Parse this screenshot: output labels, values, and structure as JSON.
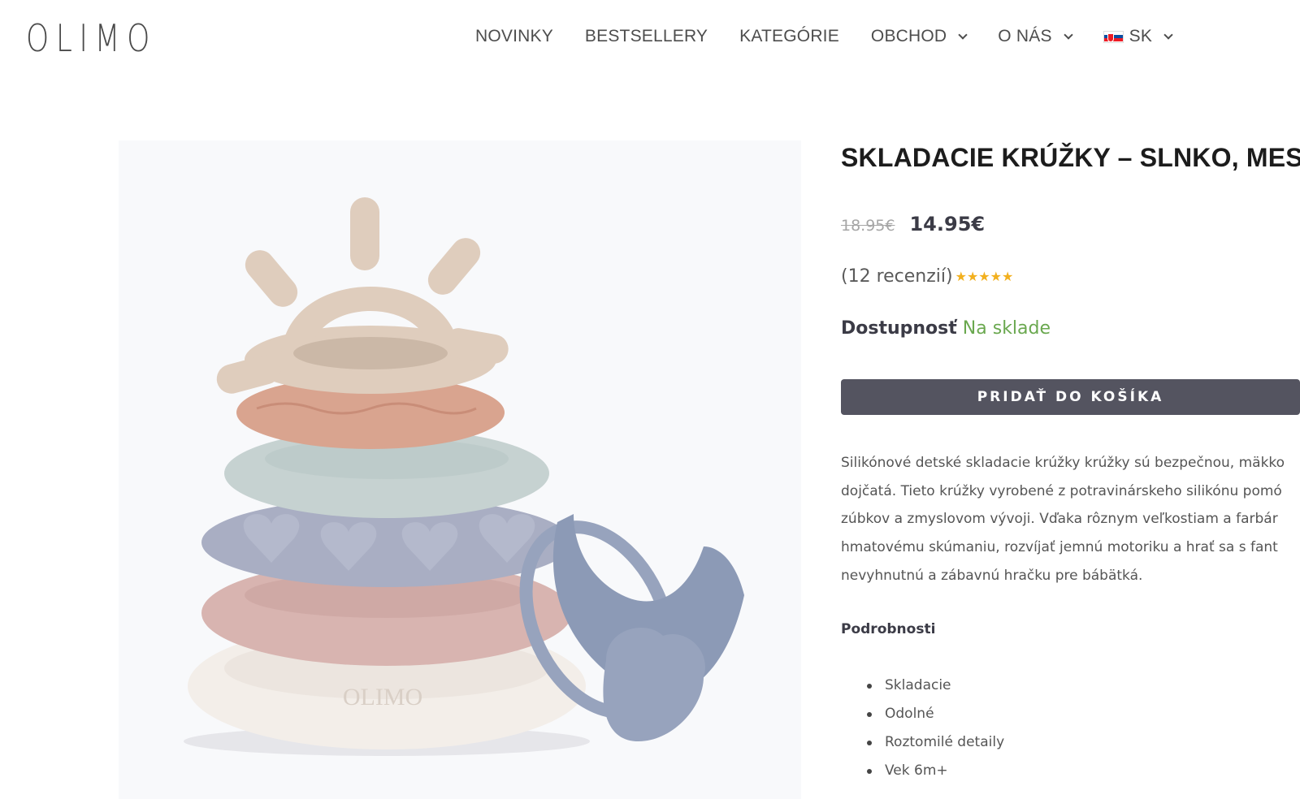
{
  "header": {
    "logo_text": "OLIMO",
    "nav": [
      {
        "label": "NOVINKY",
        "has_dropdown": false
      },
      {
        "label": "BESTSELLERY",
        "has_dropdown": false
      },
      {
        "label": "KATEGÓRIE",
        "has_dropdown": false
      },
      {
        "label": "OBCHOD",
        "has_dropdown": true
      },
      {
        "label": "O NÁS",
        "has_dropdown": true
      }
    ],
    "language": {
      "label": "SK",
      "flag": "slovakia-flag-icon"
    }
  },
  "product": {
    "title": "SKLADACIE KRÚŽKY – SLNKO, MESIAC",
    "old_price": "18.95€",
    "price": "14.95€",
    "reviews_text": "(12 recenzií)",
    "rating": 5,
    "rating_max": 5,
    "availability_label": "Dostupnosť",
    "availability_value": "Na sklade",
    "add_to_cart": "PRIDAŤ DO KOŠÍKA",
    "description_lines": [
      "Silikónové detské skladacie krúžky krúžky sú bezpečnou, mäkko",
      "dojčatá. Tieto krúžky vyrobené z potravinárskeho silikónu pomó",
      "zúbkov a zmyslovom vývoji. Vďaka rôznym veľkostiam a farbár",
      "hmatovému skúmaniu, rozvíjať jemnú motoriku a hrať sa s fant",
      "nevyhnutnú a zábavnú hračku pre bábätká."
    ],
    "details_heading": "Podrobnosti",
    "details": [
      "Skladacie",
      "Odolné",
      "Roztomilé detaily",
      "Vek 6m+"
    ],
    "image_alt": "Stacking silicone rings with sun and moon teether",
    "ring_logo_text": "OLIMO"
  },
  "colors": {
    "button": "#545460",
    "in_stock": "#6aa84f",
    "star": "#f2b01e",
    "sun": "#dfcdbd",
    "ring_terracotta": "#d9a48f",
    "ring_sage": "#c6d2d1",
    "ring_lavender": "#a9aec3",
    "ring_rose": "#d8b4b0",
    "ring_cream": "#f3eee9",
    "moon": "#8c9ab6"
  }
}
